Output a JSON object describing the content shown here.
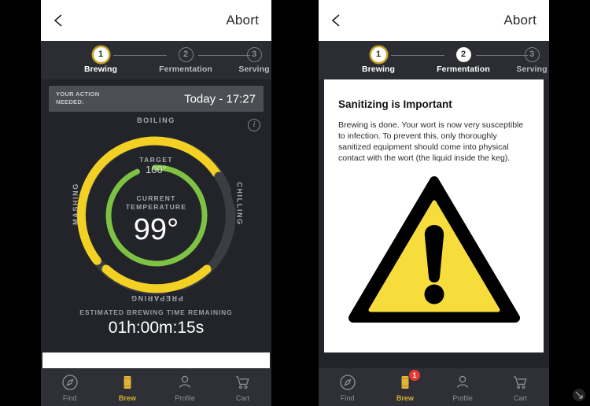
{
  "left_panel": {
    "navbar": {
      "back_icon": "chevron-left-icon",
      "abort_label": "Abort"
    },
    "stepper": {
      "steps": [
        {
          "num": "1",
          "label": "Brewing"
        },
        {
          "num": "2",
          "label": "Fermentation"
        },
        {
          "num": "3",
          "label": "Serving"
        }
      ]
    },
    "banner": {
      "title_line1": "YOUR ACTION",
      "title_line2": "NEEDED:",
      "time": "Today - 17:27"
    },
    "gauge": {
      "info_icon": "info-icon",
      "arc_labels": {
        "top": "BOILING",
        "left": "MASHING",
        "right": "CHILLING",
        "bottom": "PREPARING"
      },
      "target_label": "TARGET",
      "target_value": "100°",
      "current_label_line1": "CURRENT",
      "current_label_line2": "TEMPERATURE",
      "current_value": "99°"
    },
    "eta": {
      "label": "ESTIMATED BREWING TIME REMAINING",
      "value": "01h:00m:15s"
    },
    "tabs": [
      {
        "icon": "compass-icon",
        "label": "Find",
        "active": false,
        "badge": null
      },
      {
        "icon": "keg-icon",
        "label": "Brew",
        "active": true,
        "badge": null
      },
      {
        "icon": "person-icon",
        "label": "Profile",
        "active": false,
        "badge": null
      },
      {
        "icon": "cart-icon",
        "label": "Cart",
        "active": false,
        "badge": null
      }
    ]
  },
  "right_panel": {
    "navbar": {
      "back_icon": "chevron-left-icon",
      "abort_label": "Abort"
    },
    "stepper": {
      "steps": [
        {
          "num": "1",
          "label": "Brewing"
        },
        {
          "num": "2",
          "label": "Fermentation"
        },
        {
          "num": "3",
          "label": "Serving"
        }
      ]
    },
    "article": {
      "heading": "Sanitizing is Important",
      "body": "Brewing is done. Your wort is now very susceptible to infection. To prevent this, only thoroughly sanitized equipment should come into physical contact with the wort (the liquid inside the keg).",
      "warning_icon": "warning-triangle-icon"
    },
    "tabs": [
      {
        "icon": "compass-icon",
        "label": "Find",
        "active": false,
        "badge": null
      },
      {
        "icon": "keg-icon",
        "label": "Brew",
        "active": true,
        "badge": "1"
      },
      {
        "icon": "person-icon",
        "label": "Profile",
        "active": false,
        "badge": null
      },
      {
        "icon": "cart-icon",
        "label": "Cart",
        "active": false,
        "badge": null
      }
    ]
  },
  "colors": {
    "accent_yellow": "#f2d024",
    "green": "#7dc242",
    "track_gray": "#3b3d42",
    "panel_bg": "#222429",
    "badge_red": "#e53935",
    "warning_yellow": "#f7dd3c"
  }
}
